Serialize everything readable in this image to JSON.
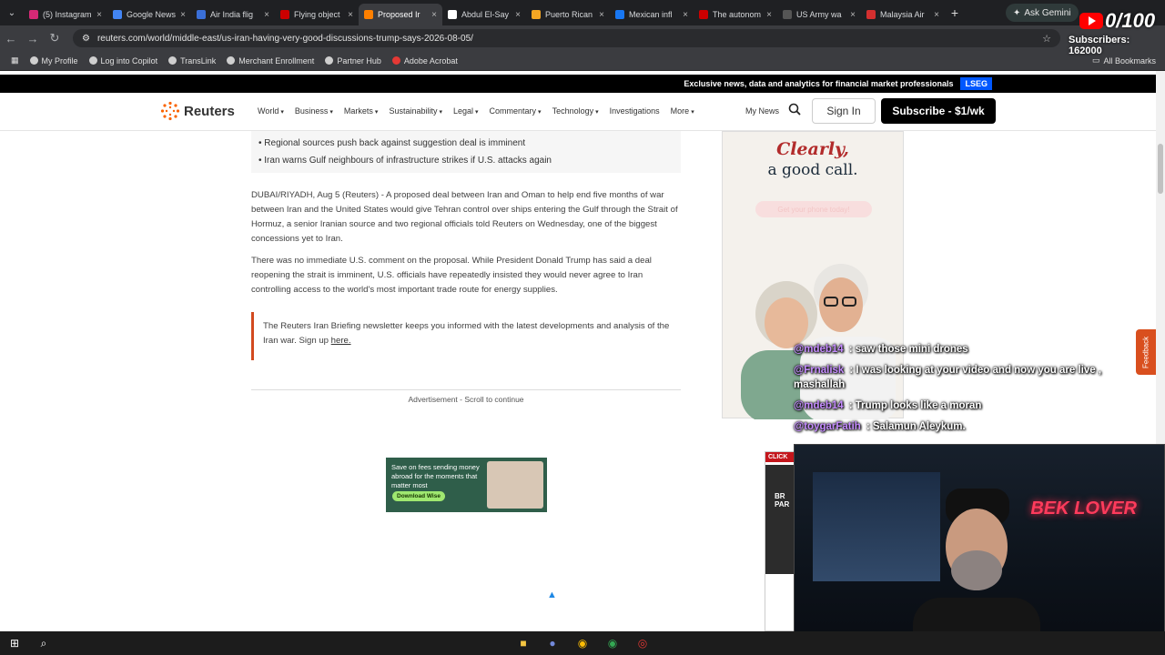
{
  "browser": {
    "tabs": [
      {
        "title": "(5) Instagram",
        "color": "#d62976"
      },
      {
        "title": "Google News",
        "color": "#4285f4"
      },
      {
        "title": "Air India flig",
        "color": "#3a6fd8"
      },
      {
        "title": "Flying object",
        "color": "#cc0000"
      },
      {
        "title": "Proposed Ir",
        "color": "#ff8000",
        "active": true
      },
      {
        "title": "Abdul El-Say",
        "color": "#ffffff"
      },
      {
        "title": "Puerto Rican",
        "color": "#f5a623"
      },
      {
        "title": "Mexican infl",
        "color": "#1877f2"
      },
      {
        "title": "The autonom",
        "color": "#cc0000"
      },
      {
        "title": "US Army wa",
        "color": "#555555"
      },
      {
        "title": "Malaysia Air",
        "color": "#d32f2f"
      }
    ],
    "gemini_label": "Ask Gemini",
    "url": "reuters.com/world/middle-east/us-iran-having-very-good-discussions-trump-says-2026-08-05/",
    "bookmarks": [
      "My Profile",
      "Log into Copilot",
      "TransLink",
      "Merchant Enrollment",
      "Partner Hub",
      "Adobe Acrobat"
    ],
    "all_bookmarks": "All Bookmarks"
  },
  "site": {
    "promo": "Exclusive news, data and analytics for financial market professionals",
    "promo_badge": "LSEG",
    "logo": "Reuters",
    "nav": [
      "World",
      "Business",
      "Markets",
      "Sustainability",
      "Legal",
      "Commentary",
      "Technology",
      "Investigations",
      "More"
    ],
    "my_news": "My News",
    "sign_in": "Sign In",
    "subscribe": "Subscribe - $1/wk"
  },
  "article": {
    "bullets": [
      "Regional sources push back against suggestion deal is imminent",
      "Iran warns Gulf neighbours of infrastructure strikes if U.S. attacks again"
    ],
    "p1": "DUBAI/RIYADH, Aug 5 (Reuters) - A proposed deal between Iran and Oman to help end five months of war between Iran and the United States would give Tehran control over ships entering the Gulf through the Strait of Hormuz, a senior Iranian source and two regional officials told Reuters on Wednesday, one of the biggest concessions yet to Iran.",
    "p2": "There was no immediate U.S. comment on the proposal. While President Donald Trump has said a deal reopening the strait is imminent, U.S. officials have repeatedly insisted they would never agree to Iran controlling access to the world's most important trade route for energy supplies.",
    "briefing": "The Reuters Iran Briefing newsletter keeps you informed with the latest developments and analysis of the Iran war. Sign up",
    "briefing_link": "here.",
    "ad_note": "Advertisement - Scroll to continue"
  },
  "ads": {
    "wise_text": "Save on fees sending money abroad for the moments that matter most",
    "wise_cta": "Download Wise",
    "side_h1": "Clearly,",
    "side_h2": "a good call.",
    "side_btn": "Get your phone today!",
    "click_tag": "CLICK",
    "click_text": "BR PAR"
  },
  "feedback": "Feedback",
  "stream": {
    "chat": [
      {
        "user": "@mdeb14",
        "msg": ": saw those mini drones"
      },
      {
        "user": "@Frnalisk",
        "msg": ": I was looking at your video and now you are live , mashallah"
      },
      {
        "user": "@mdeb14",
        "msg": ": Trump looks like a moran"
      },
      {
        "user": "@toygarFatih",
        "msg": ": Salamun Aleykum."
      }
    ],
    "goal_count": "0/100",
    "subscribers": "Subscribers: 162000",
    "neon_sign": "BEK LOVER"
  }
}
